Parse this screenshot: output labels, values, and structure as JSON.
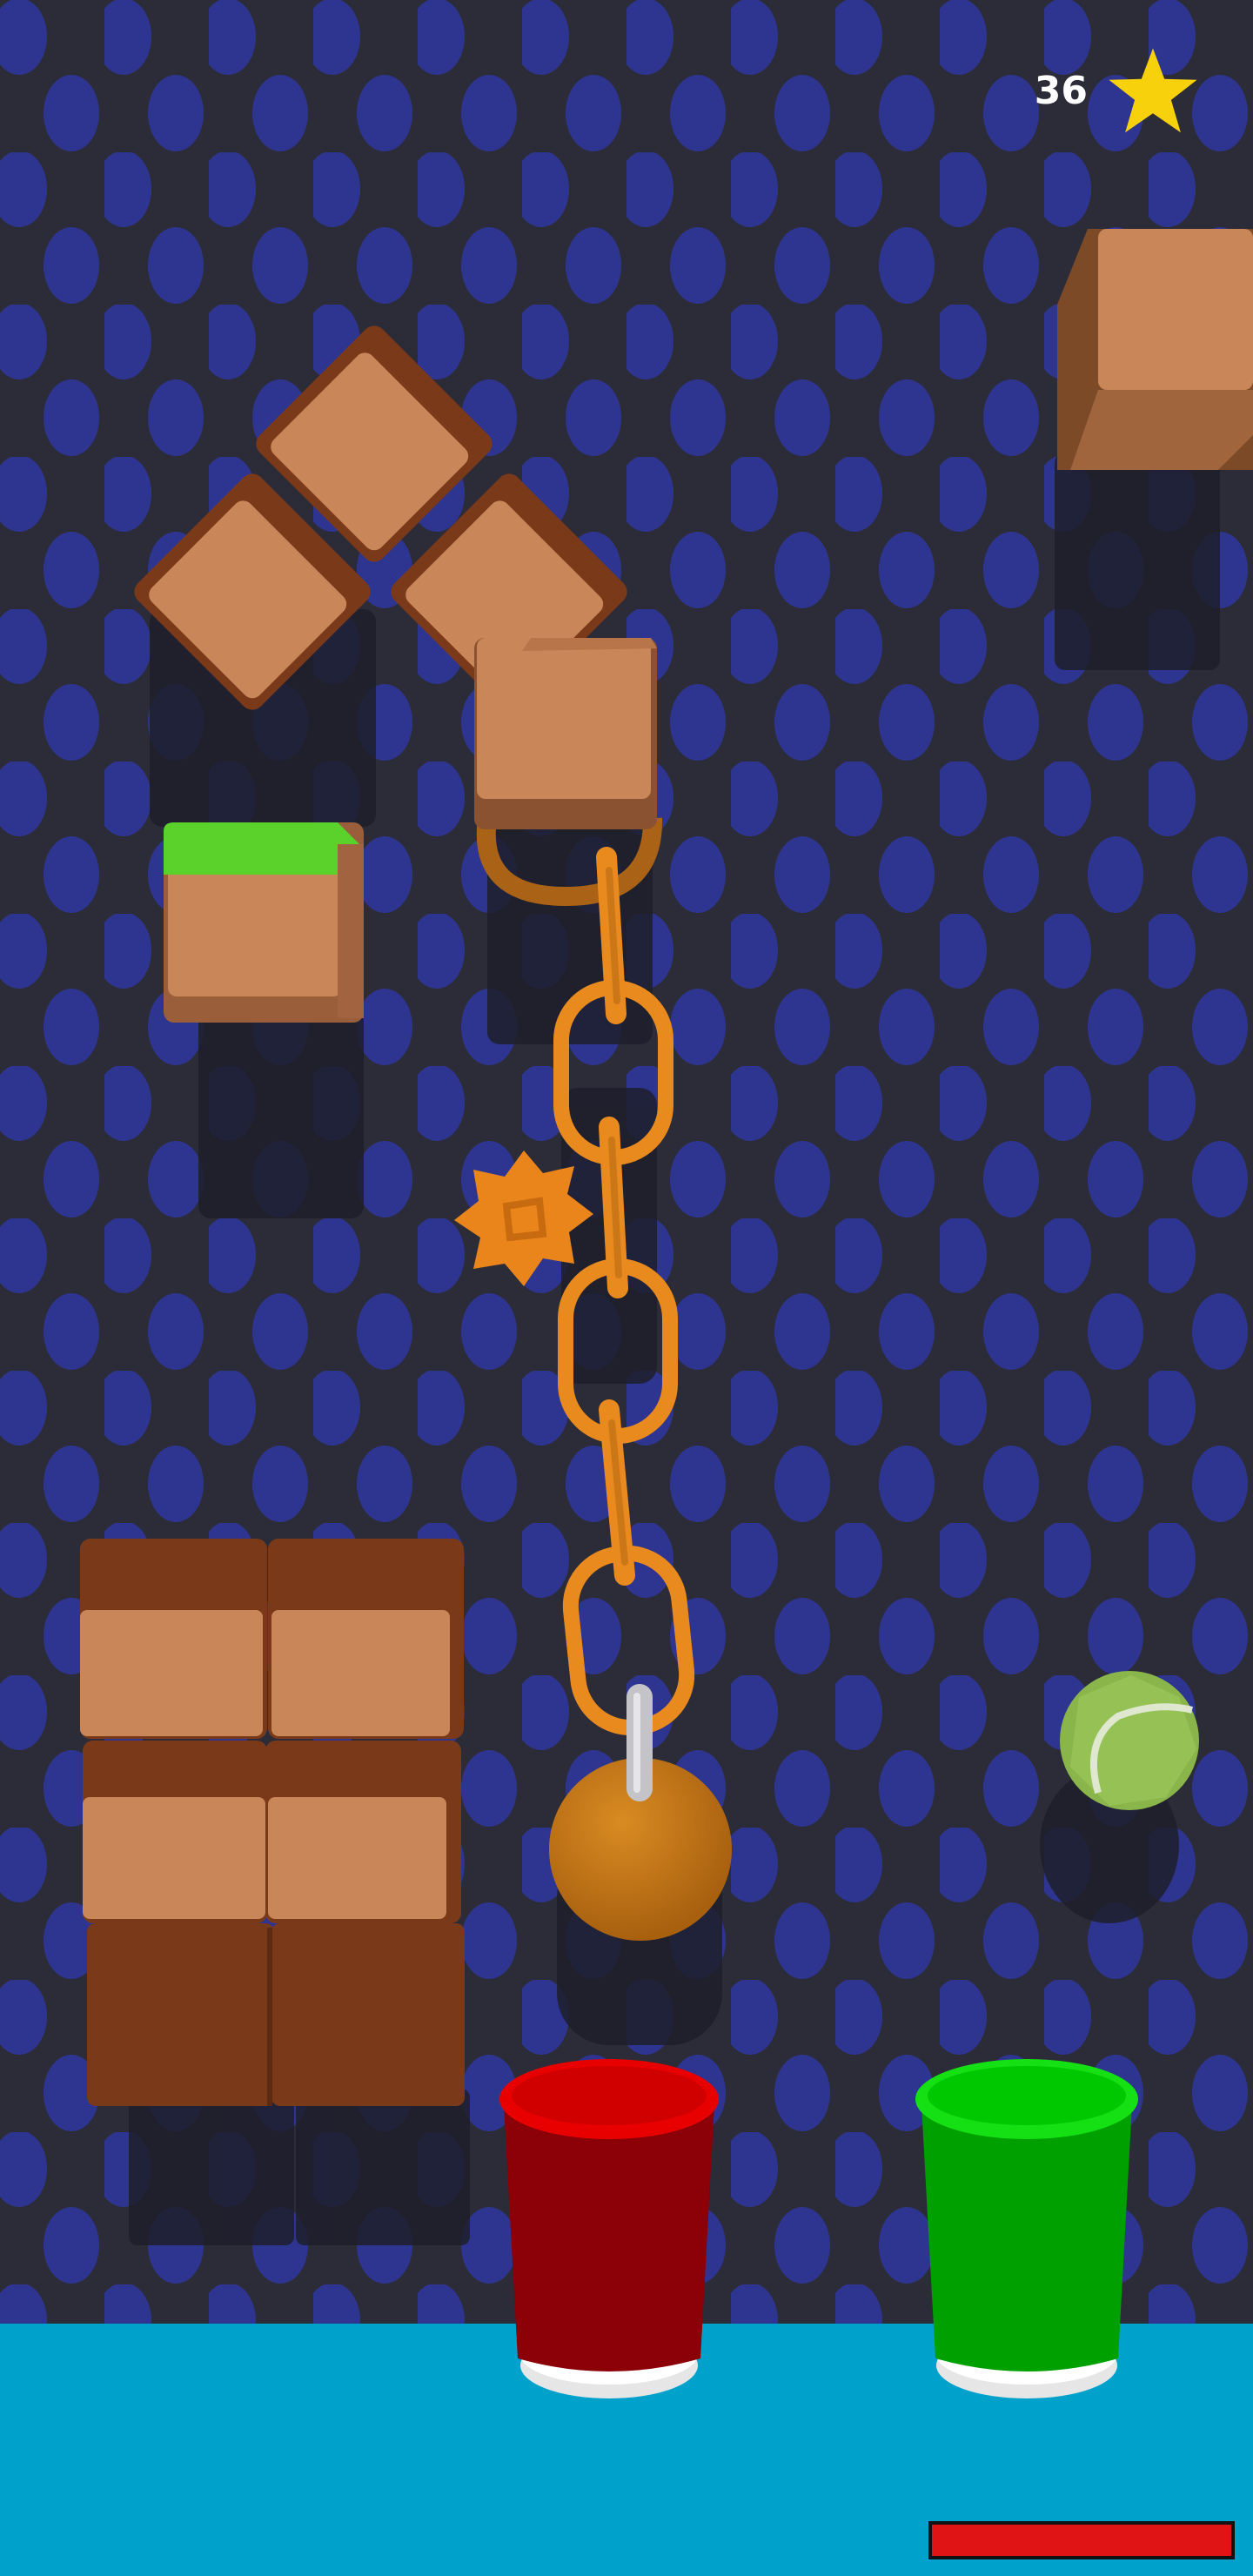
{
  "hud": {
    "score": "36",
    "score_icon": "star-icon",
    "star_color": "#f6d10c"
  },
  "progress": {
    "fill_fraction": 1.0,
    "color": "#e01414"
  },
  "scene": {
    "background_color": "#2c2b38",
    "dot_color": "#2d3590",
    "floor_color": "#00a2cc",
    "block_face_color": "#c98658",
    "block_dark_color": "#7a3a1a",
    "grass_color": "#5bd22b",
    "chain_color": "#e98a1e",
    "ball_color": "#c87918",
    "tennis_ball_color": "#8ab54b",
    "cups": [
      {
        "id": "red",
        "color": "#c80000",
        "rim": "#ee0000"
      },
      {
        "id": "green",
        "color": "#00a800",
        "rim": "#14e014"
      }
    ]
  }
}
